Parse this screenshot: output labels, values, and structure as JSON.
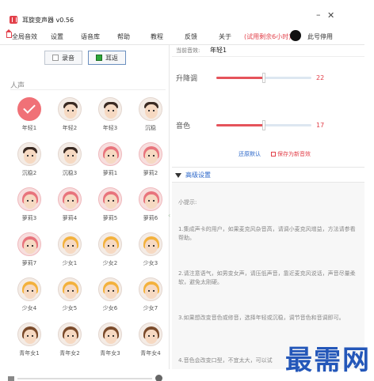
{
  "window": {
    "title": "耳旋变声器 v0.56",
    "minimize_glyph": "–",
    "close_glyph": "✕"
  },
  "menu": {
    "items": [
      "全局音效",
      "设置",
      "语音库",
      "帮助",
      "教程",
      "反馈",
      "关于"
    ],
    "trial": "(试用剩余6小时)",
    "account": "此号停用"
  },
  "toolbar": {
    "record_label": "录音",
    "ear_return_label": "耳返"
  },
  "voice_section": {
    "title": "人声",
    "selected": "年轻1",
    "voices": [
      {
        "name": "年轻1",
        "style": "selected"
      },
      {
        "name": "年轻2",
        "style": "male"
      },
      {
        "name": "年轻3",
        "style": "male"
      },
      {
        "name": "沉稳",
        "style": "male"
      },
      {
        "name": "沉稳2",
        "style": "male"
      },
      {
        "name": "沉稳3",
        "style": "male"
      },
      {
        "name": "萝莉1",
        "style": "pink"
      },
      {
        "name": "萝莉2",
        "style": "pink"
      },
      {
        "name": "萝莉3",
        "style": "pink"
      },
      {
        "name": "萝莉4",
        "style": "pink"
      },
      {
        "name": "萝莉5",
        "style": "pink"
      },
      {
        "name": "萝莉6",
        "style": "pink"
      },
      {
        "name": "萝莉7",
        "style": "pink"
      },
      {
        "name": "少女1",
        "style": "girl"
      },
      {
        "name": "少女2",
        "style": "girl"
      },
      {
        "name": "少女3",
        "style": "girl"
      },
      {
        "name": "少女4",
        "style": "girl"
      },
      {
        "name": "少女5",
        "style": "girl"
      },
      {
        "name": "少女6",
        "style": "girl"
      },
      {
        "name": "少女7",
        "style": "girl"
      },
      {
        "name": "青年女1",
        "style": "woman"
      },
      {
        "name": "青年女2",
        "style": "woman"
      },
      {
        "name": "青年女3",
        "style": "woman"
      },
      {
        "name": "青年女4",
        "style": "woman"
      },
      {
        "name": "",
        "style": "woman"
      },
      {
        "name": "",
        "style": "woman"
      },
      {
        "name": "",
        "style": "woman"
      },
      {
        "name": "",
        "style": "woman"
      }
    ]
  },
  "params": {
    "current_label": "当前音效:",
    "current_value": "年轻1",
    "pitch": {
      "label": "升降调",
      "value": 22,
      "fraction": 0.5
    },
    "timbre": {
      "label": "音色",
      "value": 17,
      "fraction": 0.5
    },
    "restore_default": "还原默认",
    "save_new": "保存为新音效"
  },
  "advanced": {
    "label": "高级设置"
  },
  "tips": {
    "title": "小提示:",
    "items": [
      "1.集成声卡的用户，如果麦克风杂音高，请调小麦克风增益，方法请参看帮助。",
      "2.请注意语气，如男变女声，请压低声音，靠近麦克风说话，声音尽量柔软，避免太刚硬。",
      "3.如果想改变音色或修音，选择年轻或沉稳，调节音色和音调即可。",
      "4.音色会改变口型，不宜太大，可以试"
    ]
  },
  "watermark": "最需网",
  "colors": {
    "accent": "#e2404a",
    "link": "#2a66c9",
    "ear_green": "#2ea83a"
  }
}
